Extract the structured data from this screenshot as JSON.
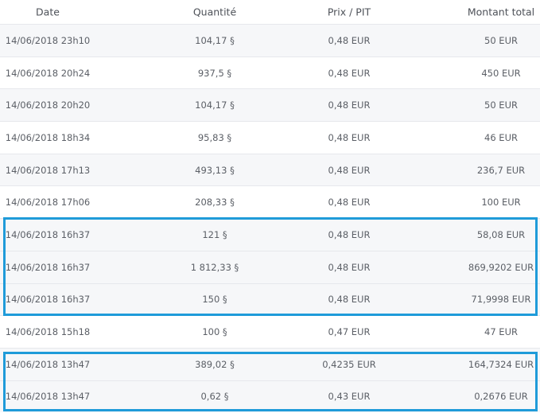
{
  "columns": {
    "date": "Date",
    "quantity": "Quantité",
    "price": "Prix / PIT",
    "total": "Montant total"
  },
  "rows": [
    {
      "date": "14/06/2018 23h10",
      "quantity": "104,17 §",
      "price": "0,48 EUR",
      "total": "50 EUR"
    },
    {
      "date": "14/06/2018 20h24",
      "quantity": "937,5 §",
      "price": "0,48 EUR",
      "total": "450 EUR"
    },
    {
      "date": "14/06/2018 20h20",
      "quantity": "104,17 §",
      "price": "0,48 EUR",
      "total": "50 EUR"
    },
    {
      "date": "14/06/2018 18h34",
      "quantity": "95,83 §",
      "price": "0,48 EUR",
      "total": "46 EUR"
    },
    {
      "date": "14/06/2018 17h13",
      "quantity": "493,13 §",
      "price": "0,48 EUR",
      "total": "236,7 EUR"
    },
    {
      "date": "14/06/2018 17h06",
      "quantity": "208,33 §",
      "price": "0,48 EUR",
      "total": "100 EUR"
    },
    {
      "date": "14/06/2018 16h37",
      "quantity": "121 §",
      "price": "0,48 EUR",
      "total": "58,08 EUR"
    },
    {
      "date": "14/06/2018 16h37",
      "quantity": "1 812,33 §",
      "price": "0,48 EUR",
      "total": "869,9202 EUR"
    },
    {
      "date": "14/06/2018 16h37",
      "quantity": "150 §",
      "price": "0,48 EUR",
      "total": "71,9998 EUR"
    },
    {
      "date": "14/06/2018 15h18",
      "quantity": "100 §",
      "price": "0,47 EUR",
      "total": "47 EUR"
    },
    {
      "date": "14/06/2018 13h47",
      "quantity": "389,02 §",
      "price": "0,4235 EUR",
      "total": "164,7324 EUR"
    },
    {
      "date": "14/06/2018 13h47",
      "quantity": "0,62 §",
      "price": "0,43 EUR",
      "total": "0,2676 EUR"
    }
  ],
  "highlight_color": "#1f9bd9"
}
